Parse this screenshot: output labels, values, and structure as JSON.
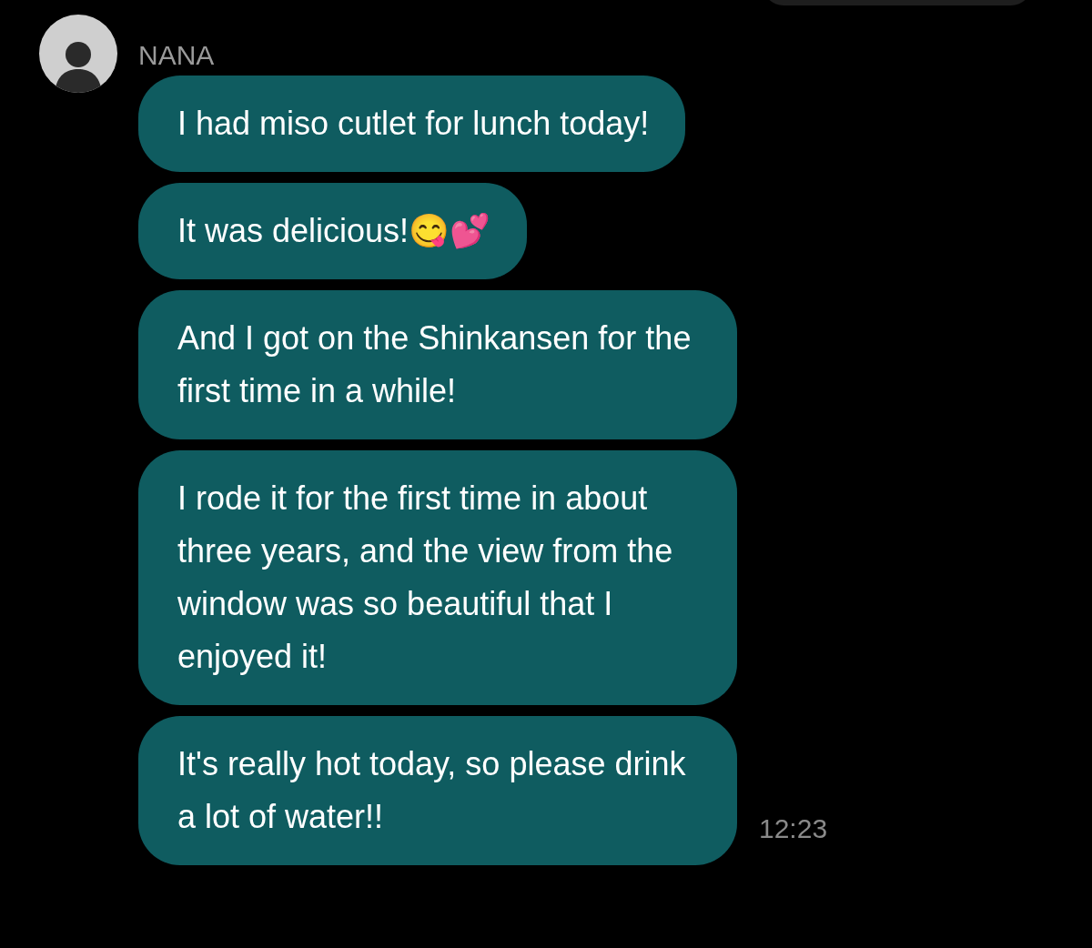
{
  "contact": {
    "name": "NANA"
  },
  "messages": [
    {
      "text": "I had miso cutlet for lunch today!"
    },
    {
      "text": "It was delicious!😋💕"
    },
    {
      "text": "And I got on the Shinkansen for the first time in a while!"
    },
    {
      "text": "I rode it for the first time in about three years, and the view from the window was so beautiful that I enjoyed it!"
    },
    {
      "text": "It's really hot today, so please drink a lot of water!!"
    }
  ],
  "time": "12:23"
}
